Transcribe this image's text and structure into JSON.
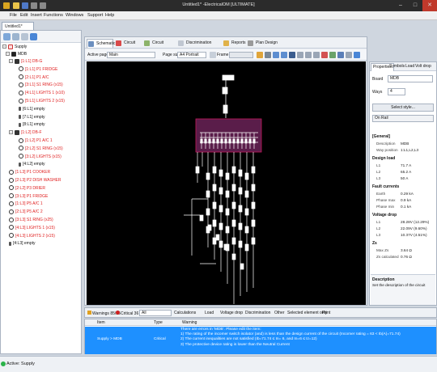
{
  "window": {
    "title": "Untitled1* -ElectricalOM [ULTIMATE]",
    "minimize": "–",
    "maximize": "□",
    "close": "✕"
  },
  "menu": [
    "File",
    "Edit",
    "Insert",
    "Functions",
    "Windows",
    "Support",
    "Help"
  ],
  "doc_tab": "Untitled1*",
  "tree": {
    "root": "Supply",
    "mdb": "MDB",
    "items": [
      {
        "label": "[1:L1] DB-G",
        "color": "red",
        "level": 2,
        "kind": "db"
      },
      {
        "label": "[1:L1] P1 FRIDGE",
        "color": "red",
        "level": 3,
        "kind": "circ"
      },
      {
        "label": "[2:L1] P1 A/C",
        "color": "red",
        "level": 3,
        "kind": "circ"
      },
      {
        "label": "[3:L1] S1 RING (x15)",
        "color": "red",
        "level": 3,
        "kind": "circ"
      },
      {
        "label": "[4:L1] LIGHTS 1 (x10)",
        "color": "red",
        "level": 3,
        "kind": "circ"
      },
      {
        "label": "[5:L1] LIGHTS 2 (x15)",
        "color": "red",
        "level": 3,
        "kind": "circ"
      },
      {
        "label": "[6:L1] empty",
        "color": "black",
        "level": 3,
        "kind": "empty"
      },
      {
        "label": "[7:L1] empty",
        "color": "black",
        "level": 3,
        "kind": "empty"
      },
      {
        "label": "[8:L1] empty",
        "color": "black",
        "level": 3,
        "kind": "empty"
      },
      {
        "label": "[1:L2] DB-F",
        "color": "red",
        "level": 2,
        "kind": "db"
      },
      {
        "label": "[1:L2] P1 A/C 1",
        "color": "red",
        "level": 3,
        "kind": "circ"
      },
      {
        "label": "[2:L2] S1 RING (x15)",
        "color": "red",
        "level": 3,
        "kind": "circ"
      },
      {
        "label": "[3:L2] LIGHTS (x15)",
        "color": "red",
        "level": 3,
        "kind": "circ"
      },
      {
        "label": "[4:L2] empty",
        "color": "black",
        "level": 3,
        "kind": "empty"
      },
      {
        "label": "[1:L3] P1 COOKER",
        "color": "red",
        "level": 2,
        "kind": "circ"
      },
      {
        "label": "[2:L3] P2 DISH WASHER",
        "color": "red",
        "level": 2,
        "kind": "circ"
      },
      {
        "label": "[2:L2] P3 DRIER",
        "color": "red",
        "level": 2,
        "kind": "circ"
      },
      {
        "label": "[3:L3] P1 FRIDGE",
        "color": "red",
        "level": 2,
        "kind": "circ"
      },
      {
        "label": "[1:L3] P5 A/C 1",
        "color": "red",
        "level": 2,
        "kind": "circ"
      },
      {
        "label": "[2:L3] P5 A/C 2",
        "color": "red",
        "level": 2,
        "kind": "circ"
      },
      {
        "label": "[3:L3] S1 RING (x25)",
        "color": "red",
        "level": 2,
        "kind": "circ"
      },
      {
        "label": "[4:L3] LIGHTS 1 (x15)",
        "color": "red",
        "level": 2,
        "kind": "circ"
      },
      {
        "label": "[4:L3] LIGHTS 2 (x15)",
        "color": "red",
        "level": 2,
        "kind": "circ"
      },
      {
        "label": "[4:L3] empty",
        "color": "black",
        "level": 2,
        "kind": "empty"
      }
    ]
  },
  "center_tabs": [
    "Schematic",
    "Circuit edit",
    "Circuit details",
    "Discrimination study",
    "Reports",
    "Plan Design"
  ],
  "options": {
    "active_page_label": "Active page",
    "active_page": "Main",
    "page_size_label": "Page size",
    "page_size": "A4 Portrait",
    "frame": "Frame"
  },
  "right": {
    "tabs": [
      "Properties",
      "Symbols",
      "Load",
      "Volt drop"
    ],
    "board_label": "Board",
    "board_value": "MDB",
    "ways_label": "Ways",
    "ways_value": "4",
    "select_style": "Select style...",
    "on_rail": "On Rail",
    "sections": [
      {
        "title": "[General]",
        "rows": [
          [
            "Description",
            "MDB"
          ],
          [
            "Way position",
            "1:L1,L2,L3"
          ]
        ]
      },
      {
        "title": "Design load",
        "rows": [
          [
            "L1",
            "71.7 A"
          ],
          [
            "L2",
            "65.2 A"
          ],
          [
            "L3",
            "50 A"
          ]
        ]
      },
      {
        "title": "Fault currents",
        "rows": [
          [
            "Earth",
            "0.29 kA"
          ],
          [
            "Phase max",
            "0.9 kA"
          ],
          [
            "Phase min",
            "0.1 kA"
          ]
        ]
      },
      {
        "title": "Voltage drop",
        "rows": [
          [
            "L1",
            "28.28V (12.29%)"
          ],
          [
            "L2",
            "22.09V (9.60%)"
          ],
          [
            "L3",
            "10.37V (4.51%)"
          ]
        ]
      },
      {
        "title": "Zs",
        "rows": [
          [
            "Max Zs",
            "3.64 Ω"
          ],
          [
            "Zs calculated",
            "0.76 Ω"
          ]
        ]
      }
    ],
    "description_title": "Description",
    "description_text": "Set the description of the circuit"
  },
  "bottom": {
    "warnings": "Warnings 85/85",
    "critical": "Critical 36",
    "filter": "All",
    "calculations": "Calculations",
    "load": "Load",
    "voltage_drop": "Voltage drop",
    "discrimination": "Discrimination",
    "other": "Other",
    "selected_only": "Selected element only",
    "print": "Print"
  },
  "grid": {
    "headers": [
      "Item",
      "Type",
      "Warning"
    ],
    "row": {
      "item": "Supply > MDB",
      "type": "Critical",
      "lines": [
        "There are errors in 'MDB'. Please edit the item:",
        "1) The rating of the incomer switch isolator (and) is less than the design current of the circuit (Incomer rating = 63 < Ib(A)=71.74)",
        "2) The current inequalities are not satisfied (Ib=71.74 ≤ In= 6, and In=6 ≤ Iz=12)",
        "3) The protective device rating is lower than the Neutral Current"
      ]
    }
  },
  "status": "Active: Supply"
}
